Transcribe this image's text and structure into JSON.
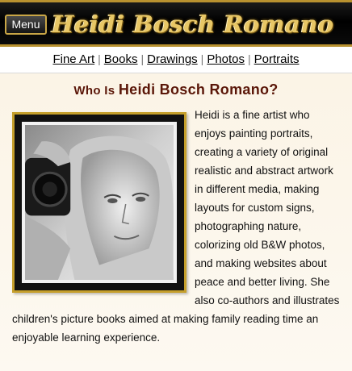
{
  "header": {
    "menu_label": "Menu",
    "logo_text": "Heidi Bosch Romano"
  },
  "nav": {
    "items": [
      "Fine Art",
      "Books",
      "Drawings",
      "Photos",
      "Portraits"
    ]
  },
  "main": {
    "heading_small": "Who Is",
    "heading_name": "Heidi Bosch Romano?",
    "bio": "Heidi is a fine artist who enjoys painting portraits, creating a variety of original realistic and abstract artwork in different media, making layouts for custom signs, photographing nature, colorizing old B&W photos, and making websites about peace and better living. She also co-authors and illustrates children's picture books aimed at making family reading time an enjoyable learning experience."
  },
  "colors": {
    "gold": "#c59f2b",
    "heading": "#5a1608"
  }
}
